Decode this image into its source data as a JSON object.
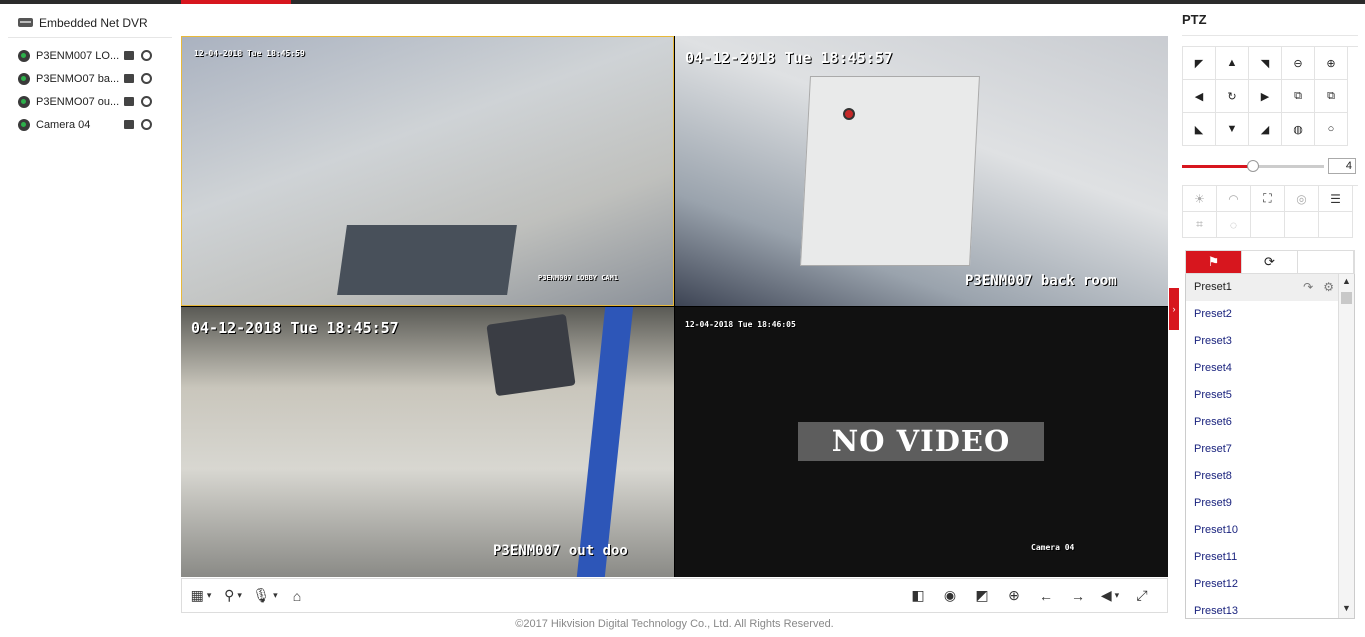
{
  "app": {
    "copyright": "©2017 Hikvision Digital Technology Co., Ltd. All Rights Reserved.",
    "accent_color": "#d7161e"
  },
  "device_tree": {
    "root_label": "Embedded Net DVR",
    "cameras": [
      {
        "label": "P3ENM007 LO..."
      },
      {
        "label": "P3ENMO07 ba..."
      },
      {
        "label": "P3ENMO07 ou..."
      },
      {
        "label": "Camera 04"
      }
    ]
  },
  "video": {
    "tiles": [
      {
        "timestamp": "12-04-2018 Tue 18:45:59",
        "name": "P3ENM007 LOBBY CAM1"
      },
      {
        "timestamp": "04-12-2018 Tue 18:45:57",
        "name": "P3ENM007 back room"
      },
      {
        "timestamp": "04-12-2018 Tue 18:45:57",
        "name": "P3ENM007 out doo"
      },
      {
        "timestamp": "12-04-2018 Tue 18:46:05",
        "name": "Camera 04",
        "status": "NO VIDEO"
      }
    ]
  },
  "ptz": {
    "title": "PTZ",
    "speed": {
      "value": "4",
      "level_fraction": 0.5
    },
    "tabs": [
      "preset",
      "patrol",
      ""
    ],
    "presets": [
      "Preset1",
      "Preset2",
      "Preset3",
      "Preset4",
      "Preset5",
      "Preset6",
      "Preset7",
      "Preset8",
      "Preset9",
      "Preset10",
      "Preset11",
      "Preset12",
      "Preset13"
    ]
  }
}
